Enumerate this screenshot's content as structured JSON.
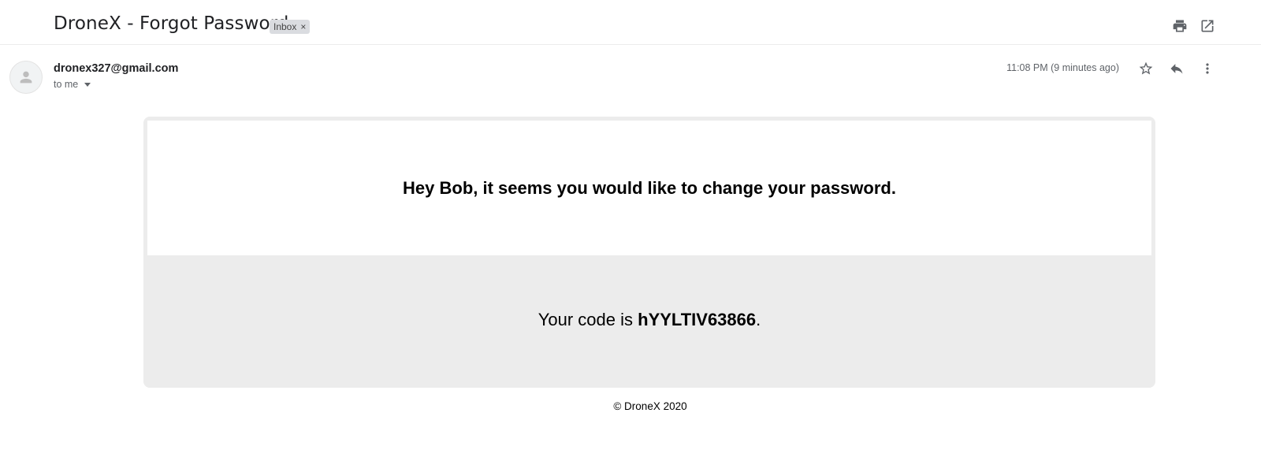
{
  "subject": "DroneX - Forgot Password",
  "label": {
    "text": "Inbox",
    "remove": "×"
  },
  "sender": {
    "email": "dronex327@gmail.com",
    "to": "to me",
    "time": "11:08 PM (9 minutes ago)"
  },
  "icons": {
    "print": "print-icon",
    "open_new_window": "open-in-new-window-icon",
    "star": "star-icon",
    "reply": "reply-icon",
    "more": "more-vert-icon",
    "avatar": "person-icon"
  },
  "body": {
    "headline": "Hey Bob, it seems you would like to change your password.",
    "code_prefix": "Your code is ",
    "code": "hYYLTIV63866",
    "code_suffix": ".",
    "footer": "© DroneX 2020"
  },
  "colors": {
    "card_background": "#ececec",
    "muted_text": "#5f6368",
    "chip_background": "#dadce0"
  }
}
